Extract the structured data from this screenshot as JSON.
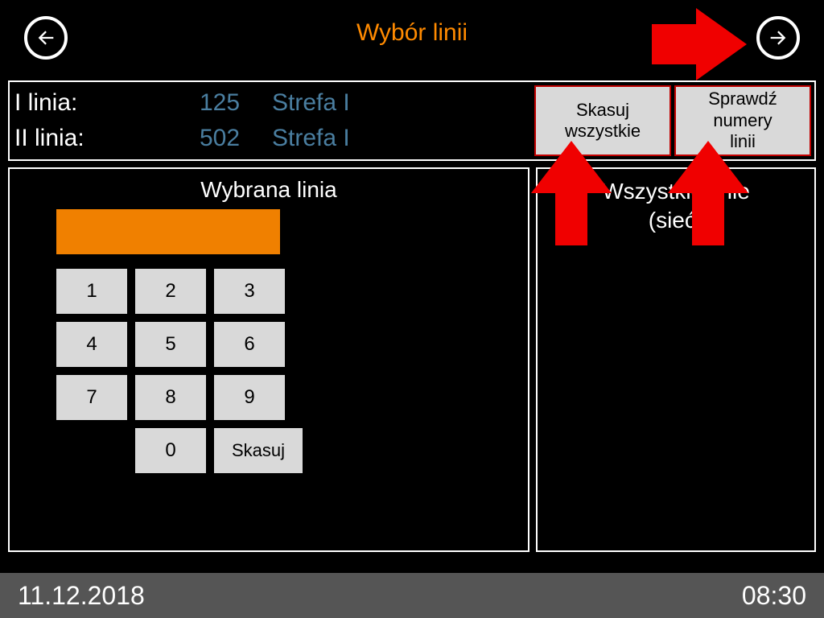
{
  "header": {
    "title": "Wybór linii"
  },
  "info": {
    "rows": [
      {
        "label": "I linia:",
        "number": "125",
        "zone": "Strefa I"
      },
      {
        "label": "II linia:",
        "number": "502",
        "zone": "Strefa I"
      }
    ],
    "delete_all_button": "Skasuj\nwszystkie",
    "check_numbers_button": "Sprawdź\nnumery\nlinii"
  },
  "left": {
    "title": "Wybrana linia",
    "keys": [
      "1",
      "2",
      "3",
      "4",
      "5",
      "6",
      "7",
      "8",
      "9",
      "0"
    ],
    "clear_label": "Skasuj"
  },
  "right": {
    "line1": "Wszystkie linie",
    "line2": "(sieć)"
  },
  "status": {
    "date": "11.12.2018",
    "time": "08:30"
  }
}
